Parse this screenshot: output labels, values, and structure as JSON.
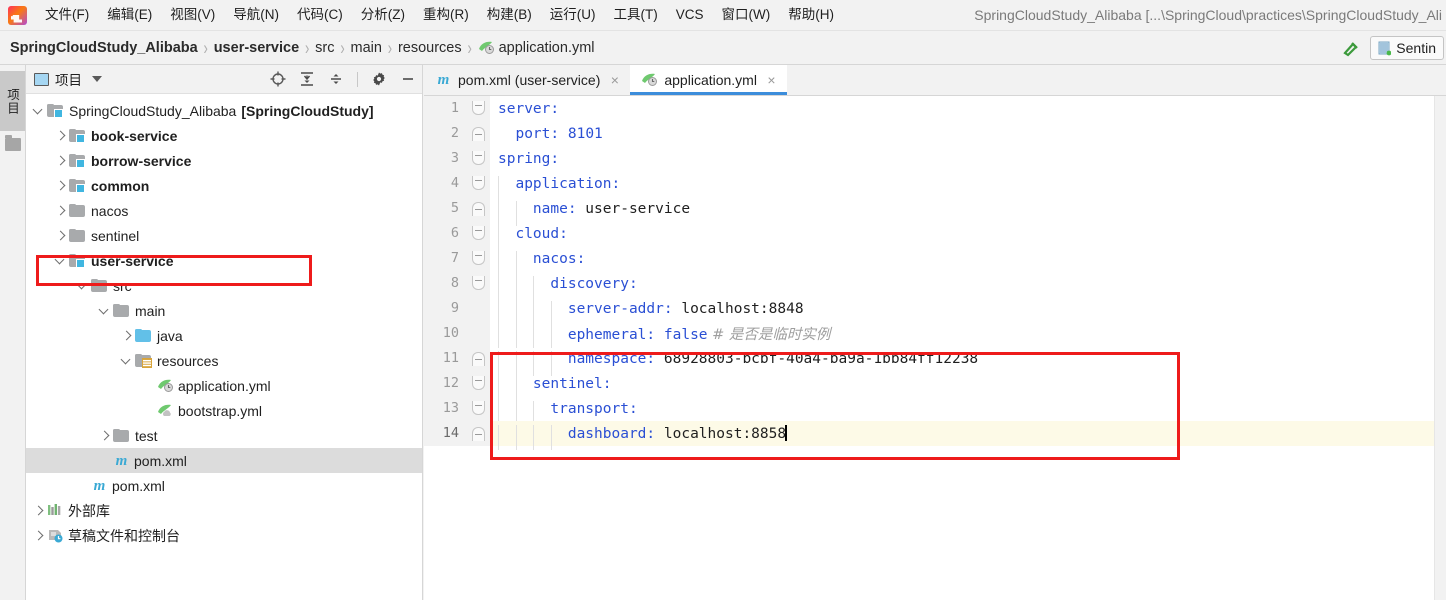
{
  "window": {
    "title": "SpringCloudStudy_Alibaba [...\\SpringCloud\\practices\\SpringCloudStudy_Ali",
    "logo_icon": "intellij-idea-logo"
  },
  "menubar": {
    "items": [
      {
        "label": "文件(F)",
        "name": "menu-file"
      },
      {
        "label": "编辑(E)",
        "name": "menu-edit"
      },
      {
        "label": "视图(V)",
        "name": "menu-view"
      },
      {
        "label": "导航(N)",
        "name": "menu-navigate"
      },
      {
        "label": "代码(C)",
        "name": "menu-code"
      },
      {
        "label": "分析(Z)",
        "name": "menu-analyze"
      },
      {
        "label": "重构(R)",
        "name": "menu-refactor"
      },
      {
        "label": "构建(B)",
        "name": "menu-build"
      },
      {
        "label": "运行(U)",
        "name": "menu-run"
      },
      {
        "label": "工具(T)",
        "name": "menu-tools"
      },
      {
        "label": "VCS",
        "name": "menu-vcs"
      },
      {
        "label": "窗口(W)",
        "name": "menu-window"
      },
      {
        "label": "帮助(H)",
        "name": "menu-help"
      }
    ]
  },
  "breadcrumb": {
    "separator": "›",
    "items": [
      {
        "label": "SpringCloudStudy_Alibaba",
        "bold": true,
        "icon": ""
      },
      {
        "label": "user-service",
        "bold": true,
        "icon": ""
      },
      {
        "label": "src",
        "bold": false,
        "icon": ""
      },
      {
        "label": "main",
        "bold": false,
        "icon": ""
      },
      {
        "label": "resources",
        "bold": false,
        "icon": ""
      },
      {
        "label": "application.yml",
        "bold": false,
        "icon": "yml-spring-icon"
      }
    ]
  },
  "toolbar_right": {
    "hammer_icon": "build-hammer-icon",
    "run_config_label": "Sentin",
    "run_config_icon": "sentinel-icon"
  },
  "toolstrip": {
    "project_tab_label": "项目",
    "structure_icon": "folder-icon"
  },
  "project_panel": {
    "title": "项目",
    "title_icon": "project-view-icon",
    "dropdown_icon": "chevron-down-icon",
    "actions": [
      {
        "name": "locate-icon",
        "label": "locate"
      },
      {
        "name": "expand-all-icon",
        "label": "expand-all"
      },
      {
        "name": "collapse-all-icon",
        "label": "collapse-all"
      },
      {
        "name": "settings-gear-icon",
        "label": "settings"
      },
      {
        "name": "hide-minimize-icon",
        "label": "hide"
      }
    ],
    "tree": [
      {
        "name": "tree-node-root",
        "depth": 0,
        "arrow": "open",
        "icon": "module-folder-icon",
        "label": "SpringCloudStudy_Alibaba",
        "bold": false,
        "meta": "[SpringCloudStudy]",
        "selected": false
      },
      {
        "name": "tree-node-book-service",
        "depth": 1,
        "arrow": "closed",
        "icon": "module-folder-icon",
        "label": "book-service",
        "bold": true,
        "meta": "",
        "selected": false
      },
      {
        "name": "tree-node-borrow-service",
        "depth": 1,
        "arrow": "closed",
        "icon": "module-folder-icon",
        "label": "borrow-service",
        "bold": true,
        "meta": "",
        "selected": false
      },
      {
        "name": "tree-node-common",
        "depth": 1,
        "arrow": "closed",
        "icon": "module-folder-icon",
        "label": "common",
        "bold": true,
        "meta": "",
        "selected": false
      },
      {
        "name": "tree-node-nacos",
        "depth": 1,
        "arrow": "closed",
        "icon": "folder-icon",
        "label": "nacos",
        "bold": false,
        "meta": "",
        "selected": false
      },
      {
        "name": "tree-node-sentinel",
        "depth": 1,
        "arrow": "closed",
        "icon": "folder-icon",
        "label": "sentinel",
        "bold": false,
        "meta": "",
        "selected": false
      },
      {
        "name": "tree-node-user-service",
        "depth": 1,
        "arrow": "open",
        "icon": "module-folder-icon",
        "label": "user-service",
        "bold": true,
        "meta": "",
        "selected": false
      },
      {
        "name": "tree-node-src",
        "depth": 2,
        "arrow": "open",
        "icon": "source-folder-icon",
        "label": "src",
        "bold": false,
        "meta": "",
        "selected": false
      },
      {
        "name": "tree-node-main",
        "depth": 3,
        "arrow": "open",
        "icon": "folder-icon",
        "label": "main",
        "bold": false,
        "meta": "",
        "selected": false
      },
      {
        "name": "tree-node-java",
        "depth": 4,
        "arrow": "closed",
        "icon": "sources-root-folder-icon",
        "label": "java",
        "bold": false,
        "meta": "",
        "selected": false
      },
      {
        "name": "tree-node-resources",
        "depth": 4,
        "arrow": "open",
        "icon": "resources-folder-icon",
        "label": "resources",
        "bold": false,
        "meta": "",
        "selected": false
      },
      {
        "name": "tree-node-application-yml",
        "depth": 5,
        "arrow": "none",
        "icon": "yml-spring-icon",
        "label": "application.yml",
        "bold": false,
        "meta": "",
        "selected": false
      },
      {
        "name": "tree-node-bootstrap-yml",
        "depth": 5,
        "arrow": "none",
        "icon": "yml-cloud-icon",
        "label": "bootstrap.yml",
        "bold": false,
        "meta": "",
        "selected": false
      },
      {
        "name": "tree-node-test",
        "depth": 3,
        "arrow": "closed",
        "icon": "folder-icon",
        "label": "test",
        "bold": false,
        "meta": "",
        "selected": false
      },
      {
        "name": "tree-node-user-service-pom",
        "depth": 3,
        "arrow": "none",
        "icon": "maven-m-icon",
        "label": "pom.xml",
        "bold": false,
        "meta": "",
        "selected": true
      },
      {
        "name": "tree-node-root-pom",
        "depth": 2,
        "arrow": "none",
        "icon": "maven-m-icon",
        "label": "pom.xml",
        "bold": false,
        "meta": "",
        "selected": false
      },
      {
        "name": "tree-node-external-libraries",
        "depth": 0,
        "arrow": "closed",
        "icon": "external-libraries-icon",
        "label": "外部库",
        "bold": false,
        "meta": "",
        "selected": false
      },
      {
        "name": "tree-node-scratches",
        "depth": 0,
        "arrow": "closed",
        "icon": "scratches-consoles-icon",
        "label": "草稿文件和控制台",
        "bold": false,
        "meta": "",
        "selected": false
      }
    ]
  },
  "editor": {
    "tabs": [
      {
        "name": "tab-pom-xml",
        "label": "pom.xml (user-service)",
        "icon": "maven-m-icon",
        "active": false,
        "close": "×"
      },
      {
        "name": "tab-application-yml",
        "label": "application.yml",
        "icon": "yml-spring-icon",
        "active": true,
        "close": "×"
      }
    ],
    "lines": [
      {
        "num": "1",
        "fold": "start",
        "indent": 0,
        "current": false,
        "tokens": [
          {
            "t": "server:",
            "c": "k"
          }
        ]
      },
      {
        "num": "2",
        "fold": "end",
        "indent": 0,
        "current": false,
        "tokens": [
          {
            "t": "  ",
            "c": "v"
          },
          {
            "t": "port:",
            "c": "k"
          },
          {
            "t": " ",
            "c": "v"
          },
          {
            "t": "8101",
            "c": "n"
          }
        ]
      },
      {
        "num": "3",
        "fold": "start",
        "indent": 0,
        "current": false,
        "tokens": [
          {
            "t": "spring:",
            "c": "k"
          }
        ]
      },
      {
        "num": "4",
        "fold": "start",
        "indent": 1,
        "current": false,
        "tokens": [
          {
            "t": "  ",
            "c": "v"
          },
          {
            "t": "application:",
            "c": "k"
          }
        ]
      },
      {
        "num": "5",
        "fold": "end",
        "indent": 2,
        "current": false,
        "tokens": [
          {
            "t": "    ",
            "c": "v"
          },
          {
            "t": "name:",
            "c": "k"
          },
          {
            "t": " user-service",
            "c": "v"
          }
        ]
      },
      {
        "num": "6",
        "fold": "start",
        "indent": 1,
        "current": false,
        "tokens": [
          {
            "t": "  ",
            "c": "v"
          },
          {
            "t": "cloud:",
            "c": "k"
          }
        ]
      },
      {
        "num": "7",
        "fold": "start",
        "indent": 2,
        "current": false,
        "tokens": [
          {
            "t": "    ",
            "c": "v"
          },
          {
            "t": "nacos:",
            "c": "k"
          }
        ]
      },
      {
        "num": "8",
        "fold": "start",
        "indent": 3,
        "current": false,
        "tokens": [
          {
            "t": "      ",
            "c": "v"
          },
          {
            "t": "discovery:",
            "c": "k"
          }
        ]
      },
      {
        "num": "9",
        "fold": "none",
        "indent": 4,
        "current": false,
        "tokens": [
          {
            "t": "        ",
            "c": "v"
          },
          {
            "t": "server-addr:",
            "c": "k"
          },
          {
            "t": " localhost:8848",
            "c": "v"
          }
        ]
      },
      {
        "num": "10",
        "fold": "none",
        "indent": 4,
        "current": false,
        "tokens": [
          {
            "t": "        ",
            "c": "v"
          },
          {
            "t": "ephemeral:",
            "c": "k"
          },
          {
            "t": " ",
            "c": "v"
          },
          {
            "t": "false",
            "c": "n"
          },
          {
            "t": " # ",
            "c": "c"
          },
          {
            "t": "是否是临时实例",
            "c": "c"
          }
        ]
      },
      {
        "num": "11",
        "fold": "end",
        "indent": 4,
        "current": false,
        "tokens": [
          {
            "t": "        ",
            "c": "v"
          },
          {
            "t": "namespace:",
            "c": "k"
          },
          {
            "t": " 68928803-bcbf-40a4-ba9a-1bb84ff12238",
            "c": "v"
          }
        ]
      },
      {
        "num": "12",
        "fold": "start",
        "indent": 2,
        "current": false,
        "tokens": [
          {
            "t": "    ",
            "c": "v"
          },
          {
            "t": "sentinel:",
            "c": "k"
          }
        ]
      },
      {
        "num": "13",
        "fold": "start",
        "indent": 3,
        "current": false,
        "tokens": [
          {
            "t": "      ",
            "c": "v"
          },
          {
            "t": "transport:",
            "c": "k"
          }
        ]
      },
      {
        "num": "14",
        "fold": "end",
        "indent": 4,
        "current": true,
        "tokens": [
          {
            "t": "        ",
            "c": "v"
          },
          {
            "t": "dashboard:",
            "c": "k"
          },
          {
            "t": " localhost:8858",
            "c": "v"
          }
        ]
      }
    ]
  },
  "annotations": {
    "tree_highlight": {
      "name": "red-highlight-user-service",
      "color": "#ee1b1b"
    },
    "editor_highlight": {
      "name": "red-highlight-sentinel-block",
      "color": "#ee1b1b"
    }
  }
}
